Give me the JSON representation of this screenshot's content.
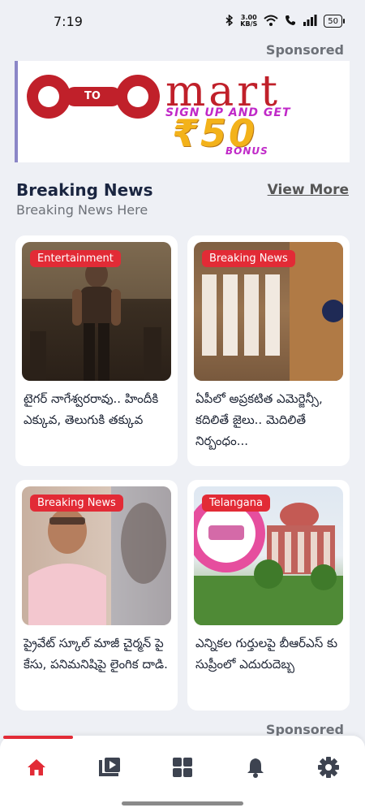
{
  "status_bar": {
    "time": "7:19",
    "net_speed_value": "3.00",
    "net_speed_unit": "KB/S",
    "battery": "50"
  },
  "ads": {
    "sponsored_label": "Sponsored",
    "banner": {
      "logo_text_left": "9",
      "logo_text_mid": "TO",
      "logo_text_right": "9",
      "brand": "mart",
      "offer_line": "SIGN UP AND GET",
      "amount": "₹50",
      "bonus": "BONUS"
    }
  },
  "section": {
    "title": "Breaking News",
    "subtitle": "Breaking News Here",
    "view_more": "View More"
  },
  "cards": [
    {
      "tag": "Entertainment",
      "title": "టైగర్ నాగేశ్వరరావు.. హిందీకి ఎక్కువ, తెలుగుకి తక్కువ"
    },
    {
      "tag": "Breaking News",
      "title": "ఏపీలో అప్రకటిత ఎమెర్జెన్సీ, కదిలితే జైలు.. మెదిలితే నిర్బంధం..."
    },
    {
      "tag": "Breaking News",
      "title": "ప్రైవేట్ స్కూల్ మాజీ చైర్మన్ పై కేసు, పనిమనిషిపై లైంగిక దాడి."
    },
    {
      "tag": "Telangana",
      "title": "ఎన్నికల గుర్తులపై బీఆర్ఎస్ కు సుప్రీంలో ఎదురుదెబ్బ"
    }
  ],
  "nav": {
    "items": [
      "home-icon",
      "video-icon",
      "grid-icon",
      "bell-icon",
      "gear-icon"
    ],
    "active_color": "#e22b36",
    "inactive_color": "#3d4350"
  }
}
